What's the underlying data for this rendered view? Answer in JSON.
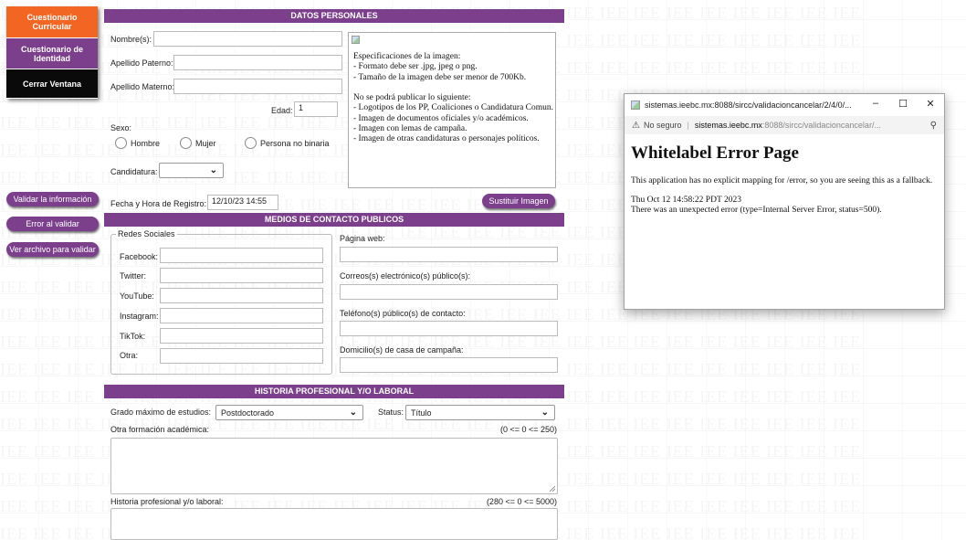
{
  "watermark": "IEE",
  "sidebar": {
    "items": [
      {
        "label": "Cuestionario Curricular"
      },
      {
        "label": "Cuestionario de Identidad"
      },
      {
        "label": "Cerrar Ventana"
      }
    ],
    "buttons": [
      {
        "label": "Validar la información"
      },
      {
        "label": "Error al validar"
      },
      {
        "label": "Ver archivo para validar"
      }
    ]
  },
  "datos_personales": {
    "title": "DATOS PERSONALES",
    "nombre_label": "Nombre(s):",
    "apellido_paterno_label": "Apellido Paterno:",
    "apellido_materno_label": "Apellido Materno:",
    "edad_label": "Edad:",
    "edad_value": "1",
    "sexo_label": "Sexo:",
    "sexo_options": [
      "Hombre",
      "Mujer",
      "Persona no binaria"
    ],
    "candidatura_label": "Candidatura:",
    "candidatura_value": "",
    "fecha_label": "Fecha y Hora de Registro:",
    "fecha_value": "12/10/23 14:55",
    "image_specs": [
      "Especificaciones de la imagen:",
      "- Formato debe ser .jpg, jpeg o png.",
      "- Tamaño de la imagen debe ser menor de 700Kb.",
      "",
      "No se podrá publicar lo siguiente:",
      "- Logotipos de los PP, Coaliciones o Candidatura Comun.",
      "- Imagen de documentos oficiales y/o académicos.",
      "- Imagen con lemas de campaña.",
      "- Imagen de otras candidaturas o personajes políticos."
    ],
    "replace_image_label": "Sustituir Imagen"
  },
  "medios_contacto": {
    "title": "MEDIOS DE CONTACTO PUBLICOS",
    "redes_legend": "Redes Sociales",
    "redes": [
      "Facebook:",
      "Twitter:",
      "YouTube:",
      "Instagram:",
      "TikTok:",
      "Otra:"
    ],
    "pagina_web_label": "Página web:",
    "correos_label": "Correos(s) electrónico(s) público(s):",
    "telefonos_label": "Teléfono(s) público(s) de contacto:",
    "domicilio_label": "Domicilio(s) de casa de campaña:"
  },
  "historia": {
    "title": "HISTORIA PROFESIONAL Y/O LABORAL",
    "grado_label": "Grado máximo de estudios:",
    "grado_value": "Postdoctorado",
    "status_label": "Status:",
    "status_value": "Título",
    "otra_formacion_label": "Otra formación académica:",
    "otra_formacion_counter": "(0 <= 0 <= 250)",
    "historia_label": "Historia profesional y/o laboral:",
    "historia_counter": "(280 <= 0 <= 5000)"
  },
  "popup": {
    "title": "sistemas.ieebc.mx:8088/sircc/validacioncancelar/2/4/0/...",
    "security": "No seguro",
    "url_host": "sistemas.ieebc.mx",
    "url_rest": ":8088/sircc/validacioncancelar/...",
    "heading": "Whitelabel Error Page",
    "message": "This application has no explicit mapping for /error, so you are seeing this as a fallback.",
    "timestamp": "Thu Oct 12 14:58:22 PDT 2023",
    "error": "There was an unexpected error (type=Internal Server Error, status=500)."
  }
}
